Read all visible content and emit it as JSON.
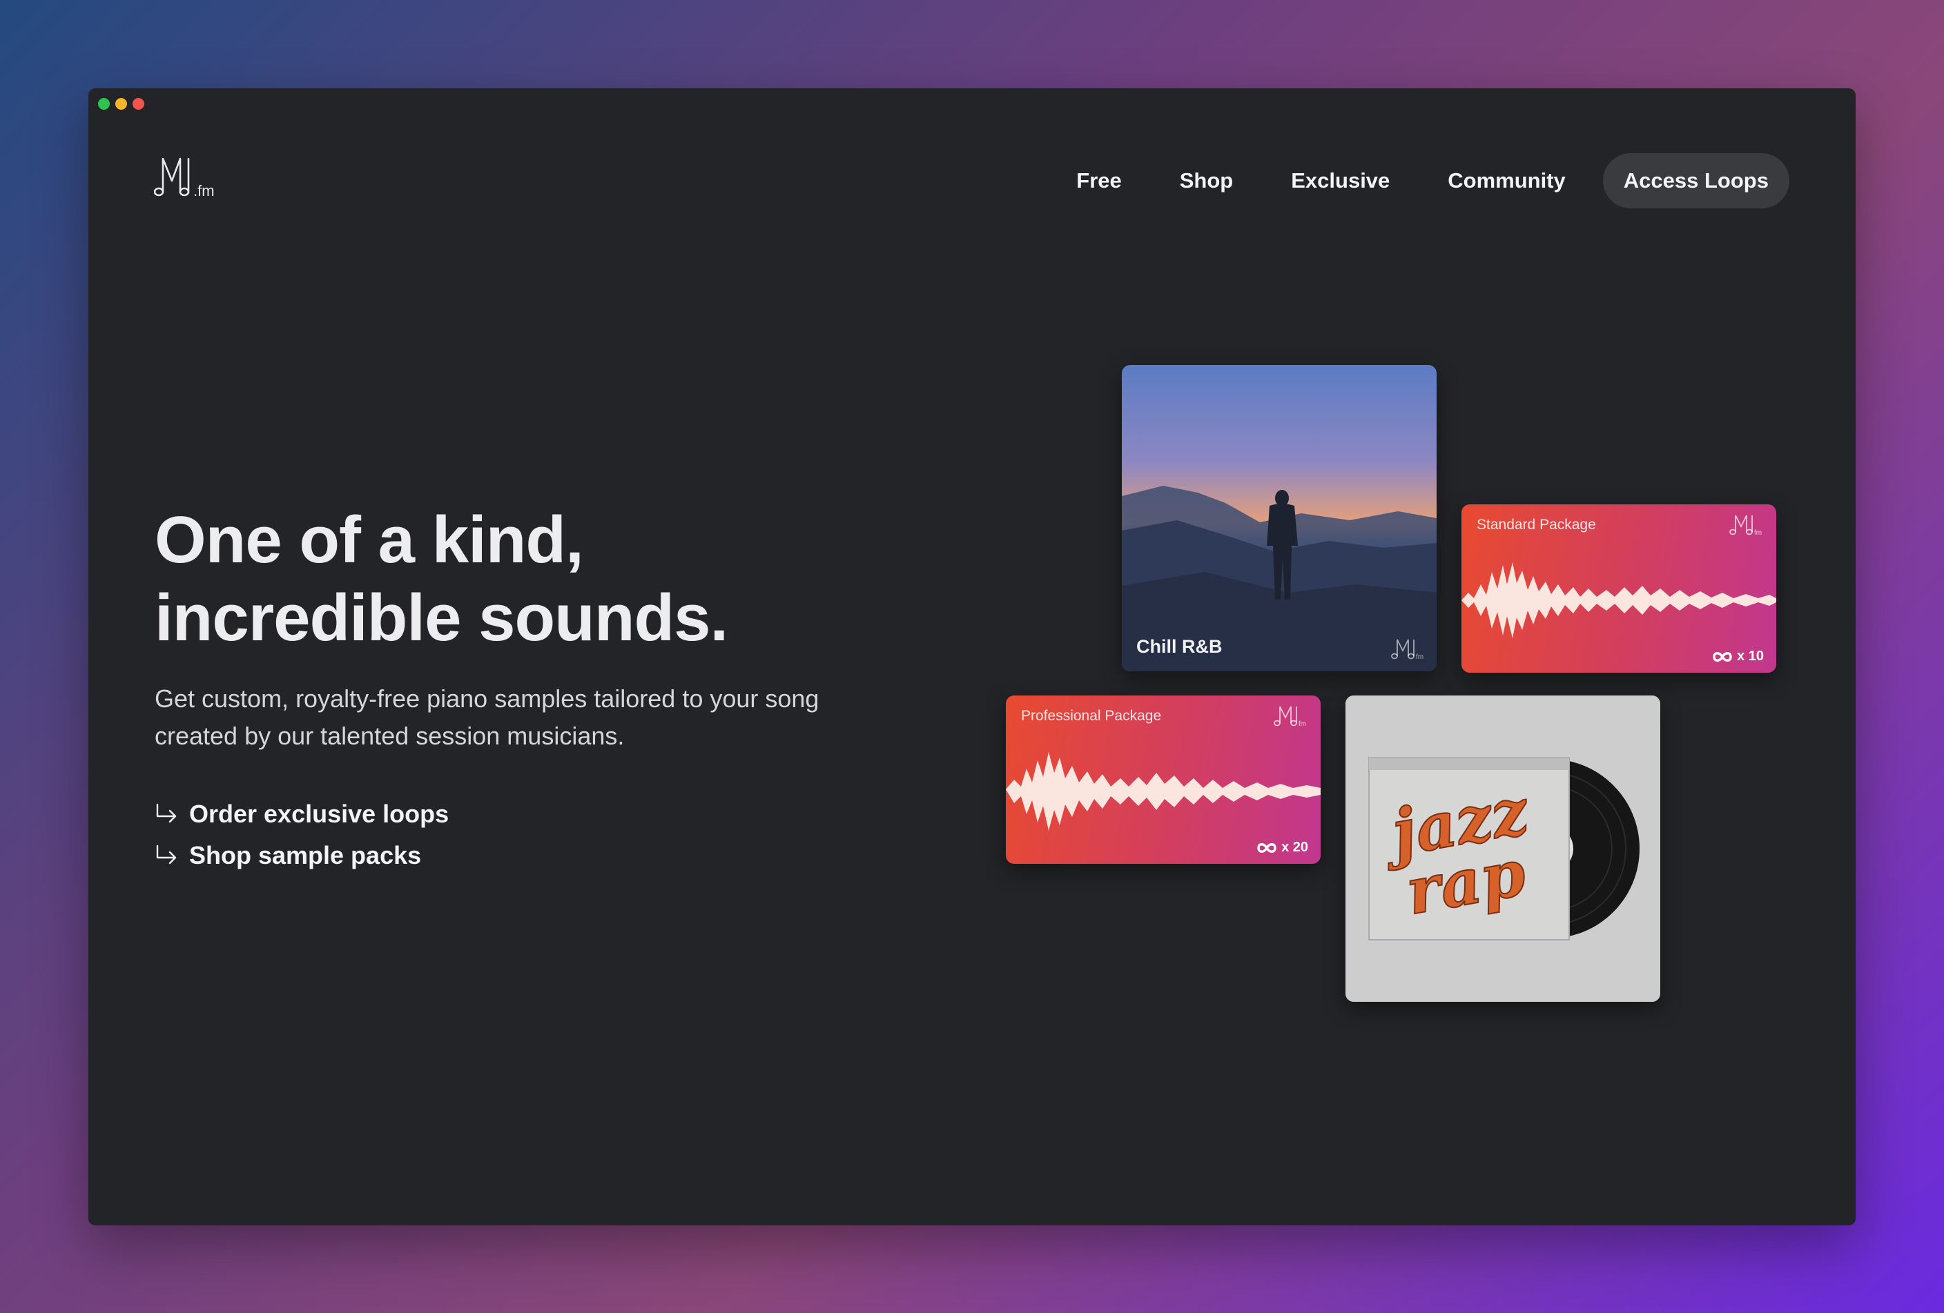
{
  "window": {
    "traffic_lights": [
      {
        "name": "green",
        "color": "#2fc44e"
      },
      {
        "name": "yellow",
        "color": "#f5b62b"
      },
      {
        "name": "red",
        "color": "#f3554d"
      }
    ]
  },
  "header": {
    "logo_text": ".fm",
    "nav": [
      {
        "label": "Free"
      },
      {
        "label": "Shop"
      },
      {
        "label": "Exclusive"
      },
      {
        "label": "Community"
      },
      {
        "label": "Access Loops"
      }
    ]
  },
  "hero": {
    "title_line1": "One of a kind,",
    "title_line2": "incredible sounds.",
    "subtitle": "Get custom, royalty-free piano samples tailored to your song created by our talented session musicians.",
    "links": [
      {
        "label": "Order exclusive loops",
        "icon": "return-arrow-icon"
      },
      {
        "label": "Shop sample packs",
        "icon": "return-arrow-icon"
      }
    ]
  },
  "cards": {
    "chill": {
      "title": "Chill R&B"
    },
    "standard": {
      "label": "Standard Package",
      "count": "x 10",
      "icon": "infinity-icon"
    },
    "pro": {
      "label": "Professional Package",
      "count": "x 20",
      "icon": "infinity-icon"
    },
    "vinyl": {
      "cover_text": "jazz rap"
    }
  },
  "colors": {
    "accent_gradient_start": "#e84a30",
    "accent_gradient_end": "#c1378f",
    "window_bg": "#232427"
  }
}
